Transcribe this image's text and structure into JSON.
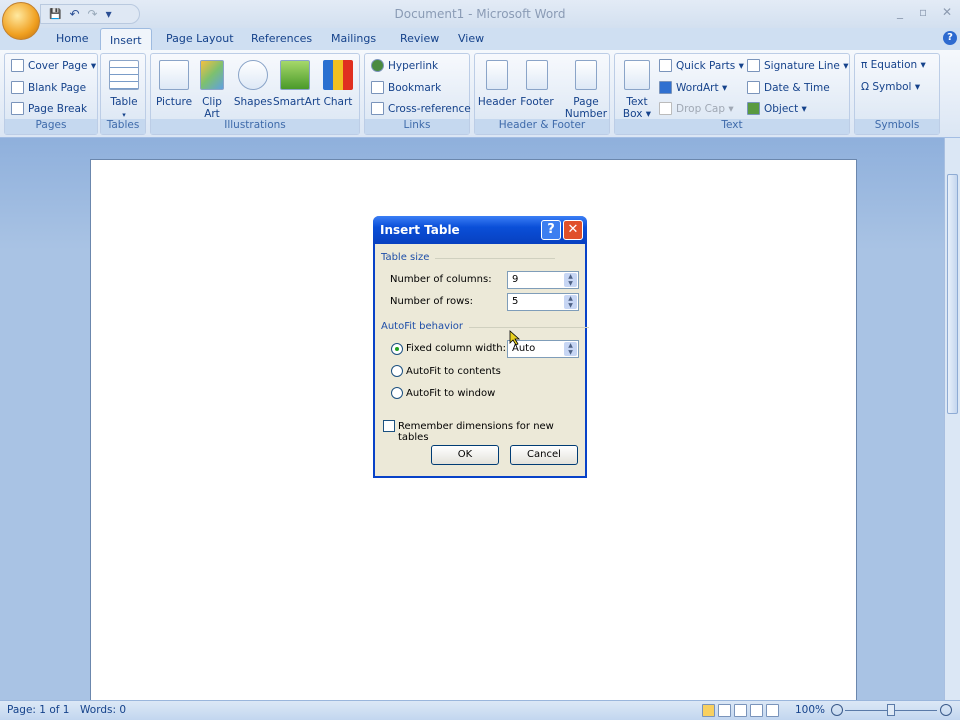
{
  "window": {
    "title": "Document1 - Microsoft Word",
    "minimize": "_",
    "restore": "▫",
    "close": "✕"
  },
  "qat": {
    "save": "💾",
    "undo": "↶",
    "redo": "↷",
    "more": "▾"
  },
  "tabs": [
    "Home",
    "Insert",
    "Page Layout",
    "References",
    "Mailings",
    "Review",
    "View"
  ],
  "active_tab": "Insert",
  "help": "?",
  "ribbon": {
    "pages": {
      "label": "Pages",
      "items": [
        "Cover Page ▾",
        "Blank Page",
        "Page Break"
      ]
    },
    "tables": {
      "label": "Tables",
      "table": "Table",
      "arrow": "▾"
    },
    "illustrations": {
      "label": "Illustrations",
      "items": [
        "Picture",
        "Clip Art",
        "Shapes",
        "SmartArt",
        "Chart"
      ]
    },
    "links": {
      "label": "Links",
      "items": [
        "Hyperlink",
        "Bookmark",
        "Cross-reference"
      ]
    },
    "header_footer": {
      "label": "Header & Footer",
      "items": [
        "Header",
        "Footer",
        "Page Number ▾"
      ]
    },
    "text": {
      "label": "Text",
      "text_box": "Text Box ▾",
      "items": [
        "Quick Parts ▾",
        "WordArt ▾",
        "Drop Cap ▾",
        "Signature Line ▾",
        "Date & Time",
        "Object ▾"
      ]
    },
    "symbols": {
      "label": "Symbols",
      "items": [
        "π Equation ▾",
        "Ω Symbol ▾"
      ]
    }
  },
  "dialog": {
    "title": "Insert Table",
    "help": "?",
    "close": "✕",
    "table_size": "Table size",
    "columns_label": "Number of columns:",
    "columns_value": "9",
    "rows_label": "Number of rows:",
    "rows_value": "5",
    "autofit_section": "AutoFit behavior",
    "fixed_label": "Fixed column width:",
    "fixed_value": "Auto",
    "autofit_contents": "AutoFit to contents",
    "autofit_window": "AutoFit to window",
    "remember": "Remember dimensions for new tables",
    "ok": "OK",
    "cancel": "Cancel"
  },
  "status": {
    "page": "Page: 1 of 1",
    "words": "Words: 0",
    "zoom": "100%"
  }
}
